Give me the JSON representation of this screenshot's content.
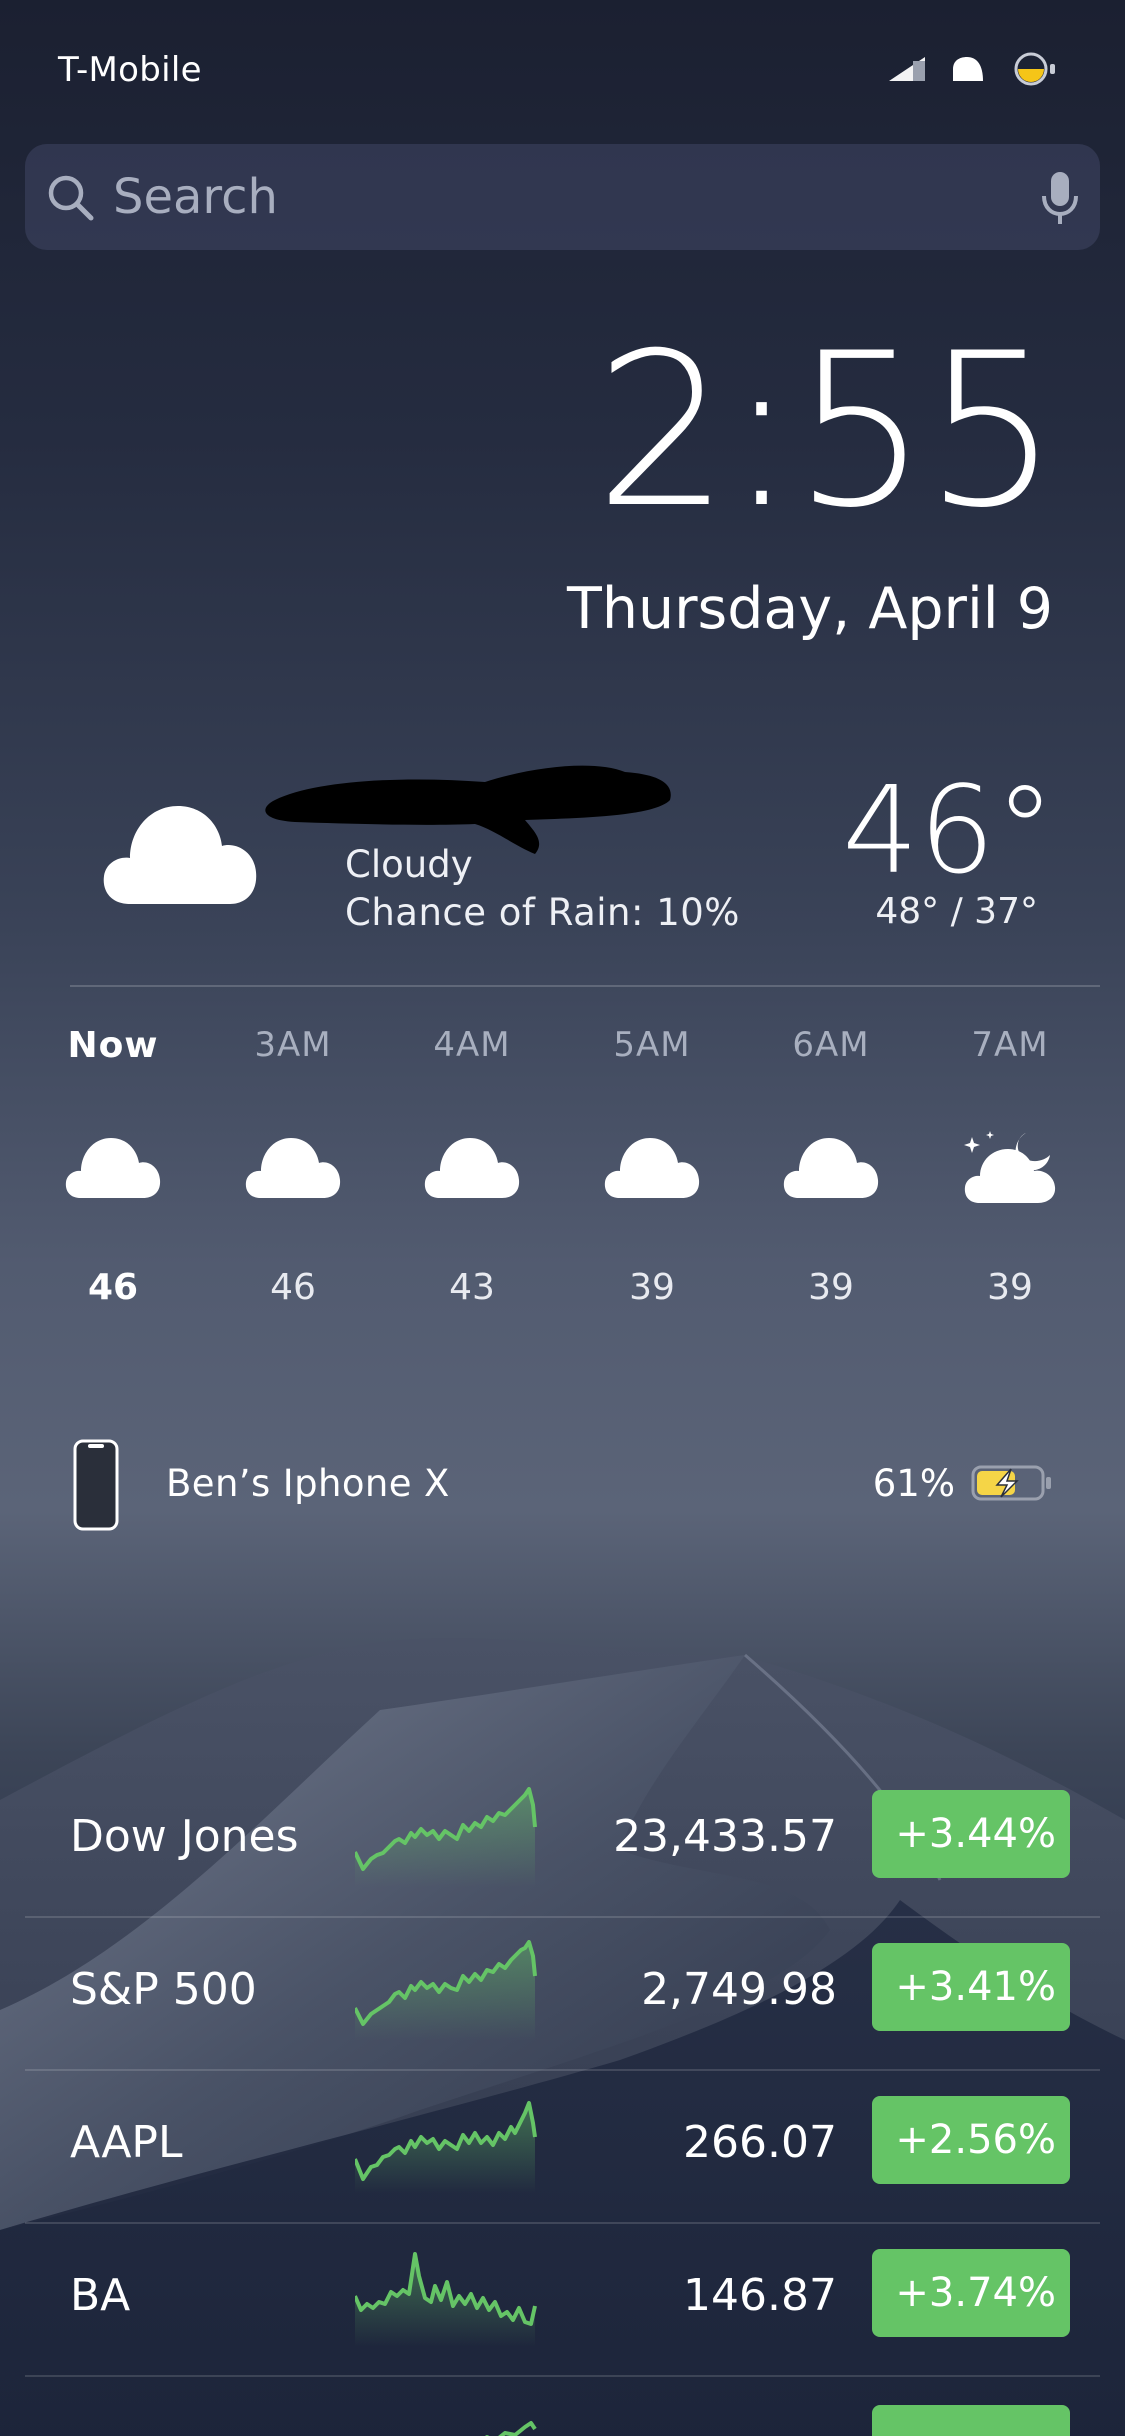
{
  "status_bar": {
    "carrier": "T-Mobile",
    "signal_icon": "cellular-signal-icon",
    "wifi_icon": "wifi-icon",
    "battery_icon": "battery-low-power-icon",
    "battery_color": "#f5c518"
  },
  "search": {
    "placeholder": "Search",
    "icon": "search-icon",
    "mic_icon": "microphone-icon"
  },
  "lock": {
    "time": "2:55",
    "date": "Thursday, April 9"
  },
  "weather": {
    "icon": "cloud-icon",
    "condition": "Cloudy",
    "rain_chance": "Chance of Rain: 10%",
    "temperature": "46°",
    "high_low": "48° / 37°",
    "hourly": [
      {
        "label": "Now",
        "icon": "cloud-icon",
        "temp": "46"
      },
      {
        "label": "3AM",
        "icon": "cloud-icon",
        "temp": "46"
      },
      {
        "label": "4AM",
        "icon": "cloud-icon",
        "temp": "43"
      },
      {
        "label": "5AM",
        "icon": "cloud-icon",
        "temp": "39"
      },
      {
        "label": "6AM",
        "icon": "cloud-icon",
        "temp": "39"
      },
      {
        "label": "7AM",
        "icon": "partly-cloudy-night-icon",
        "temp": "39"
      }
    ]
  },
  "batteries": {
    "device_name": "Ben’s Iphone X",
    "percent": "61%",
    "charge_level": 0.61,
    "device_icon": "iphone-icon",
    "charging_icon": "battery-charging-icon",
    "charge_color": "#f5d547"
  },
  "stocks": {
    "positive_color": "#65c466",
    "rows": [
      {
        "symbol": "Dow Jones",
        "price": "23,433.57",
        "change": "+3.44%"
      },
      {
        "symbol": "S&P 500",
        "price": "2,749.98",
        "change": "+3.41%"
      },
      {
        "symbol": "AAPL",
        "price": "266.07",
        "change": "+2.56%"
      },
      {
        "symbol": "BA",
        "price": "146.87",
        "change": "+3.74%"
      }
    ]
  }
}
